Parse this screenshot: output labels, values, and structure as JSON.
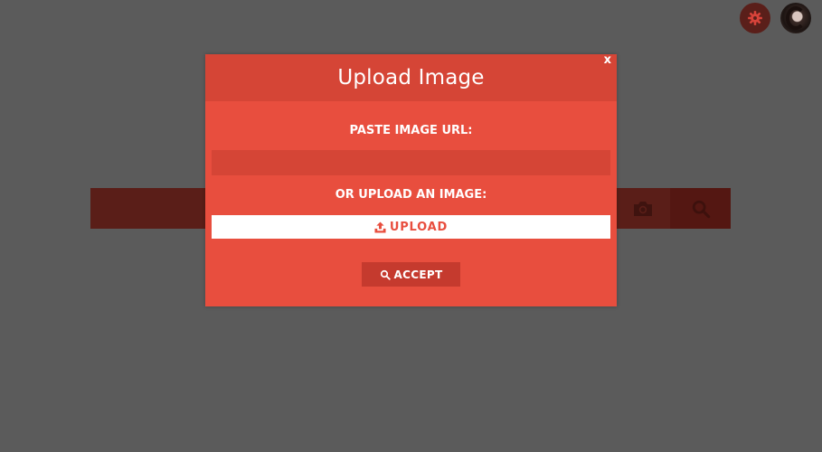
{
  "header": {
    "settings_icon": "gear-icon",
    "avatar": "user-avatar"
  },
  "search_bar": {
    "camera_icon": "camera-icon",
    "search_icon": "search-icon"
  },
  "modal": {
    "title": "Upload Image",
    "close_label": "x",
    "url_label": "PASTE IMAGE URL:",
    "url_value": "",
    "upload_label": "OR UPLOAD AN IMAGE:",
    "upload_button": "UPLOAD",
    "upload_icon": "upload-icon",
    "accept_button": "ACCEPT",
    "accept_icon": "search-icon"
  },
  "colors": {
    "overlay": "#5b5b5b",
    "modal_bg": "#e84e3e",
    "modal_header": "#d54536",
    "input_bg": "#d54536",
    "accept_bg": "#c53a2e",
    "search_bar_bg": "#5a1e18"
  }
}
